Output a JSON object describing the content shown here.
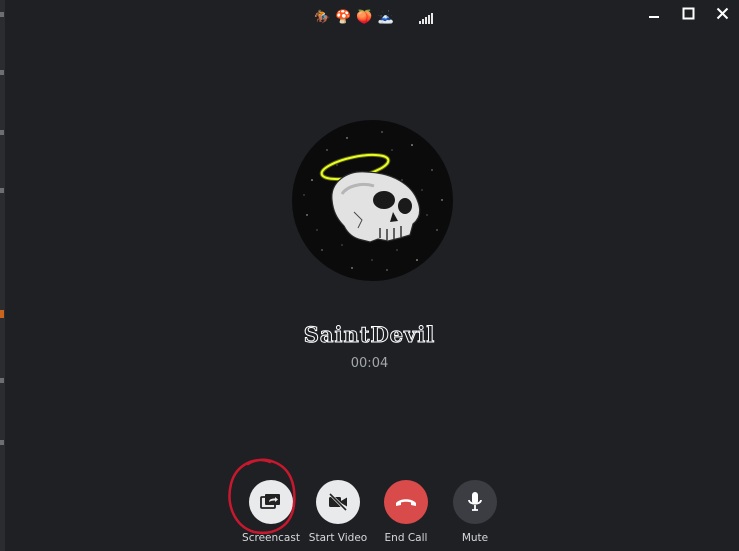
{
  "topbar": {
    "emojis": [
      "🏇",
      "🍄",
      "🍑",
      "🗻"
    ],
    "icons": [
      "horse-racing-icon",
      "mushroom-icon",
      "peach-icon",
      "mountain-icon",
      "signal-strength-icon"
    ]
  },
  "window_controls": [
    "minimize-icon",
    "maximize-icon",
    "close-icon"
  ],
  "call": {
    "name": "SaintDevil",
    "duration": "00:04"
  },
  "buttons": {
    "screencast": "Screencast",
    "start_video": "Start Video",
    "end_call": "End Call",
    "mute": "Mute"
  },
  "colors": {
    "background": "#1e2024",
    "end_call": "#d94a4a",
    "light_button": "#e9eaeb",
    "dark_button": "#3b3d42",
    "annotation": "#c9182e"
  }
}
